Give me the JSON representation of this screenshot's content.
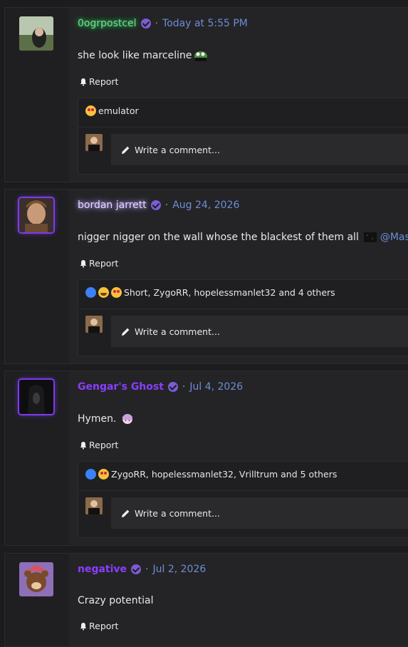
{
  "posts": [
    {
      "username": "0ogrpostcel",
      "date": "Today at 5:55 PM",
      "body": "she look like marceline",
      "report_label": "Report",
      "reactions_text": "emulator",
      "comment_placeholder": "Write a comment..."
    },
    {
      "username": "bordan jarrett",
      "date": "Aug 24, 2026",
      "body": "nigger nigger on the wall whose the blackest of them all",
      "mention": "@Master",
      "report_label": "Report",
      "reactions_text": "Short, ZygoRR, hopelessmanlet32 and 4 others",
      "comment_placeholder": "Write a comment..."
    },
    {
      "username": "Gengar's Ghost",
      "date": "Jul 4, 2026",
      "body": "Hymen.",
      "report_label": "Report",
      "reactions_text": "ZygoRR, hopelessmanlet32, Vrilltrum and 5 others",
      "comment_placeholder": "Write a comment..."
    },
    {
      "username": "negative",
      "date": "Jul 2, 2026",
      "body": "Crazy potential",
      "report_label": "Report"
    }
  ],
  "colors": {
    "background": "#1c1c1e",
    "date_link": "#6d8dd6",
    "verified_badge": "#7c5cd6",
    "purple_name": "#8b3dff"
  },
  "icons": [
    "verified-badge-icon",
    "bell-icon",
    "pencil-icon",
    "like-reaction-icon",
    "laugh-reaction-icon",
    "love-eyes-reaction-icon"
  ]
}
